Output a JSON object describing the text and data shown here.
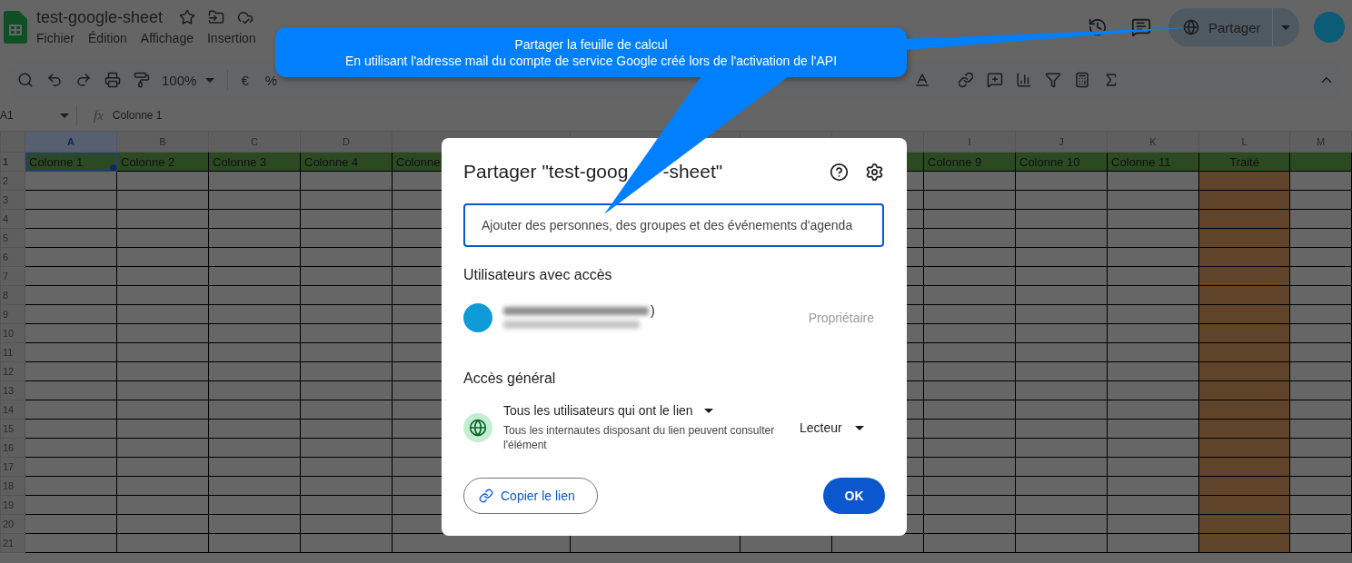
{
  "document": {
    "title": "test-google-sheet"
  },
  "menu": [
    "Fichier",
    "Édition",
    "Affichage",
    "Insertion"
  ],
  "share_button": {
    "label": "Partager"
  },
  "toolbar": {
    "zoom": "100%",
    "currency": "€",
    "percent": "%"
  },
  "formula_bar": {
    "cell_ref": "A1",
    "formula_icon": "fx",
    "value": "Colonne 1"
  },
  "sheet": {
    "columns": [
      {
        "letter": "A",
        "header": "Colonne 1",
        "selected": true,
        "highlighted": false
      },
      {
        "letter": "B",
        "header": "Colonne 2",
        "selected": false,
        "highlighted": false
      },
      {
        "letter": "C",
        "header": "Colonne 3",
        "selected": false,
        "highlighted": false
      },
      {
        "letter": "D",
        "header": "Colonne 4",
        "selected": false,
        "highlighted": false
      },
      {
        "header": "Colonne",
        "selected": false,
        "highlighted": false
      },
      {
        "selected": false,
        "highlighted": false
      },
      {
        "selected": false,
        "highlighted": false
      },
      {
        "selected": false,
        "highlighted": false
      },
      {
        "letter": "I",
        "header": "Colonne 9",
        "selected": false,
        "highlighted": false
      },
      {
        "letter": "J",
        "header": "Colonne 10",
        "selected": false,
        "highlighted": false
      },
      {
        "letter": "K",
        "header": "Colonne 11",
        "selected": false,
        "highlighted": false
      },
      {
        "letter": "L",
        "header": "Traité",
        "selected": false,
        "highlighted": true
      },
      {
        "letter": "M",
        "selected": false,
        "highlighted": false
      }
    ],
    "rows": [
      "1",
      "2",
      "3",
      "4",
      "5",
      "6",
      "7",
      "8",
      "9",
      "10",
      "11",
      "12",
      "13",
      "14",
      "15",
      "16",
      "17",
      "18",
      "19",
      "20",
      "21"
    ]
  },
  "callout": {
    "lines": [
      "Partager la feuille de calcul",
      "En utilisant l'adresse mail du compte de service Google créé lors de l'activation de l'API"
    ]
  },
  "dialog": {
    "title_parts": [
      "Partager \"test-goog",
      "-sheet\""
    ],
    "input": {
      "placeholder": "Ajouter des personnes, des groupes et des événements d'agenda"
    },
    "users_heading": "Utilisateurs avec accès",
    "user": {
      "name_tail": ")",
      "role": "Propriétaire"
    },
    "general_heading": "Accès général",
    "access": {
      "scope": "Tous les utilisateurs qui ont le lien",
      "description": "Tous les internautes disposant du lien peuvent consulter l'élément",
      "role": "Lecteur"
    },
    "copy_button": "Copier le lien",
    "ok_button": "OK"
  }
}
